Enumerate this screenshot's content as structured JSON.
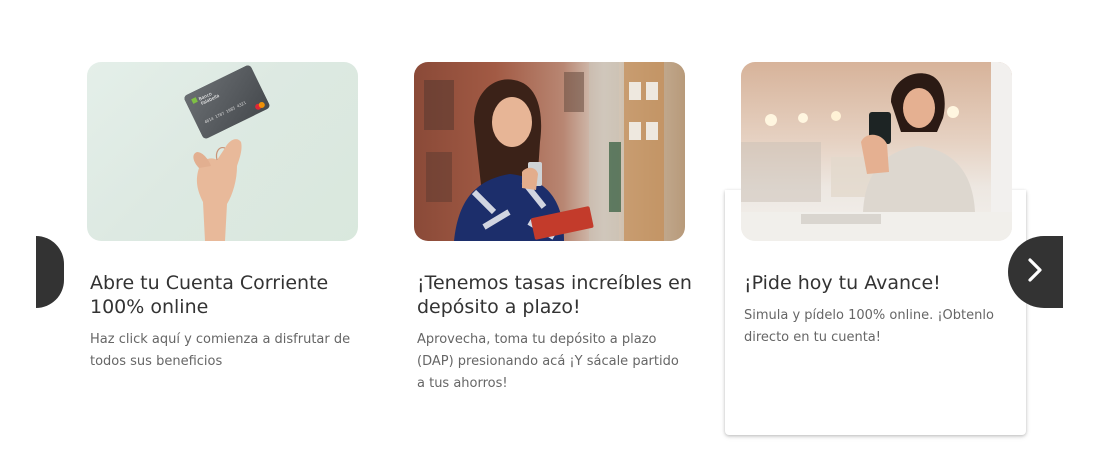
{
  "carousel": {
    "cards": [
      {
        "title": "Abre tu Cuenta Corriente 100% online",
        "description": "Haz click aquí y comienza a disfrutar de todos sus beneficios",
        "card_brand_text": "Banco Falabella"
      },
      {
        "title": "¡Tenemos tasas increíbles en depósito a plazo!",
        "description": "Aprovecha, toma tu depósito a plazo (DAP) presionando acá ¡Y sácale partido a tus ahorros!"
      },
      {
        "title": "¡Pide hoy tu Avance!",
        "description": "Simula y pídelo 100% online. ¡Obtenlo directo en tu cuenta!"
      }
    ],
    "prev_icon": "chevron-left-icon",
    "next_icon": "chevron-right-icon"
  },
  "colors": {
    "arrow_bg": "#333333",
    "title": "#333333",
    "description": "#666666"
  }
}
